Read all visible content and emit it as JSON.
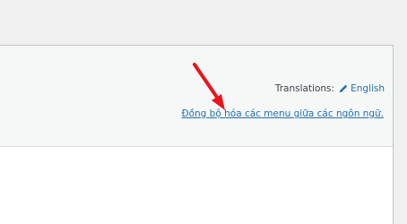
{
  "header": {
    "translations_label": "Translations:",
    "language_icon": "pencil-icon",
    "language_label": "English",
    "sync_link_label": "Đồng bộ hóa các menu giữa các ngôn ngữ."
  },
  "annotation": {
    "arrow_color": "#e8141c"
  },
  "colors": {
    "link": "#2271b1",
    "background": "#f0f0f1",
    "panel_header": "#f6f7f7",
    "panel_body": "#ffffff"
  }
}
